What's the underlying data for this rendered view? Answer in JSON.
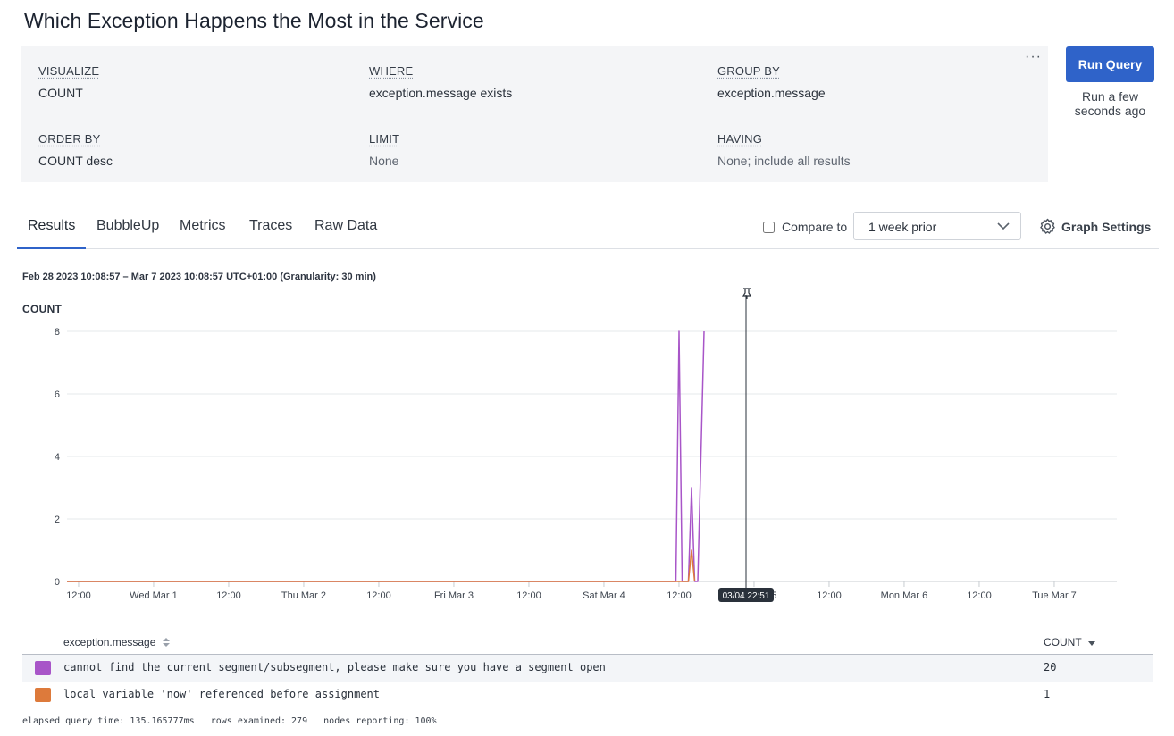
{
  "page": {
    "title": "Which Exception Happens the Most in the Service"
  },
  "query": {
    "visualize": {
      "label": "VISUALIZE",
      "value": "COUNT"
    },
    "where": {
      "label": "WHERE",
      "value": "exception.message exists"
    },
    "group_by": {
      "label": "GROUP BY",
      "value": "exception.message"
    },
    "order_by": {
      "label": "ORDER BY",
      "value": "COUNT desc"
    },
    "limit": {
      "label": "LIMIT",
      "value": "None"
    },
    "having": {
      "label": "HAVING",
      "value": "None; include all results"
    },
    "more_icon": "ellipsis-icon",
    "run_label": "Run Query",
    "run_status": "Run a few seconds ago"
  },
  "tabs": [
    {
      "label": "Results",
      "active": true
    },
    {
      "label": "BubbleUp",
      "active": false
    },
    {
      "label": "Metrics",
      "active": false
    },
    {
      "label": "Traces",
      "active": false
    },
    {
      "label": "Raw Data",
      "active": false
    }
  ],
  "compare": {
    "label": "Compare to",
    "checked": false,
    "selected": "1 week prior"
  },
  "graph_settings": {
    "label": "Graph Settings",
    "icon": "gear-icon"
  },
  "time_range": "Feb 28 2023 10:08:57 – Mar 7 2023 10:08:57 UTC+01:00 (Granularity: 30 min)",
  "colors": {
    "accent": "#2f63c9",
    "series1": "#a855c8",
    "series2": "#dd7a3b"
  },
  "chart_data": {
    "type": "line",
    "ylabel": "COUNT",
    "ylim": [
      0,
      8
    ],
    "y_ticks": [
      "0",
      "2",
      "4",
      "6",
      "8"
    ],
    "x_tick_labels": [
      "12:00",
      "Wed Mar 1",
      "12:00",
      "Thu Mar 2",
      "12:00",
      "Fri Mar 3",
      "12:00",
      "Sat Mar 4",
      "12:00",
      "Sun Mar 5",
      "12:00",
      "Mon Mar 6",
      "12:00",
      "Tue Mar 7"
    ],
    "grid": true,
    "marker": {
      "label": "03/04 22:51",
      "icon": "pin-icon"
    },
    "series": [
      {
        "name": "cannot find the current segment/subsegment, please make sure you have a segment open",
        "points": [
          [
            "2023-03-04 11:30",
            0
          ],
          [
            "2023-03-04 12:00",
            8
          ],
          [
            "2023-03-04 12:30",
            0
          ],
          [
            "2023-03-04 13:00",
            0
          ],
          [
            "2023-03-04 13:30",
            0
          ],
          [
            "2023-03-04 14:00",
            3
          ],
          [
            "2023-03-04 14:30",
            0
          ],
          [
            "2023-03-04 15:00",
            0
          ],
          [
            "2023-03-04 16:00",
            8
          ]
        ]
      },
      {
        "name": "local variable 'now' referenced before assignment",
        "points": [
          [
            "2023-03-04 13:30",
            0
          ],
          [
            "2023-03-04 14:00",
            1
          ],
          [
            "2023-03-04 14:30",
            0
          ]
        ]
      }
    ]
  },
  "table": {
    "headers": {
      "group": "exception.message",
      "count": "COUNT"
    },
    "rows": [
      {
        "message": "cannot find the current segment/subsegment, please make sure you have a segment open",
        "count": "20",
        "color": "#a855c8"
      },
      {
        "message": "local variable 'now' referenced before assignment",
        "count": "1",
        "color": "#dd7a3b"
      }
    ]
  },
  "footer": "elapsed query time: 135.165777ms   rows examined: 279   nodes reporting: 100%"
}
